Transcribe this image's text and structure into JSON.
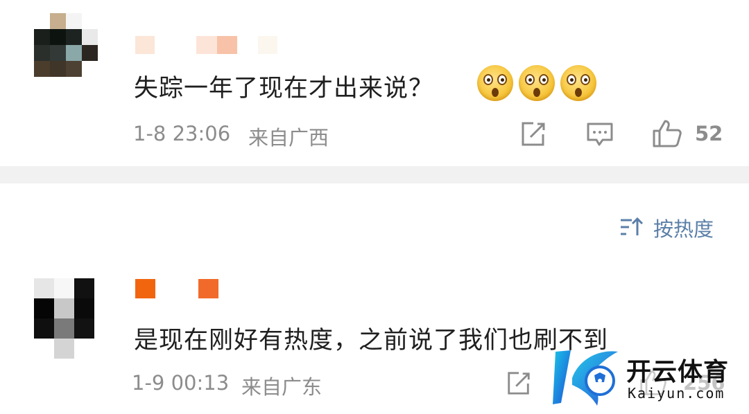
{
  "comments": [
    {
      "text": "失踪一年了现在才出来说？",
      "emoji": [
        "flushed-face-emoji",
        "flushed-face-emoji",
        "flushed-face-emoji"
      ],
      "timestamp": "1-8 23:06",
      "location": "来自广西",
      "likes": "52"
    },
    {
      "text": "是现在刚好有热度，之前说了我们也刷不到",
      "timestamp": "1-9 00:13",
      "location": "来自广东",
      "likes": "256"
    }
  ],
  "sort": {
    "label": "按热度",
    "icon": "sort-icon"
  },
  "watermark": {
    "brand": "开云体育",
    "domain": "Kaiyun.com",
    "logo_letter": "K"
  },
  "colors": {
    "meta_gray": "#8c8c8c",
    "sort_blue": "#5b7fa8",
    "divider": "#f1f1f1",
    "watermark_blue": "#1f6fd6"
  }
}
